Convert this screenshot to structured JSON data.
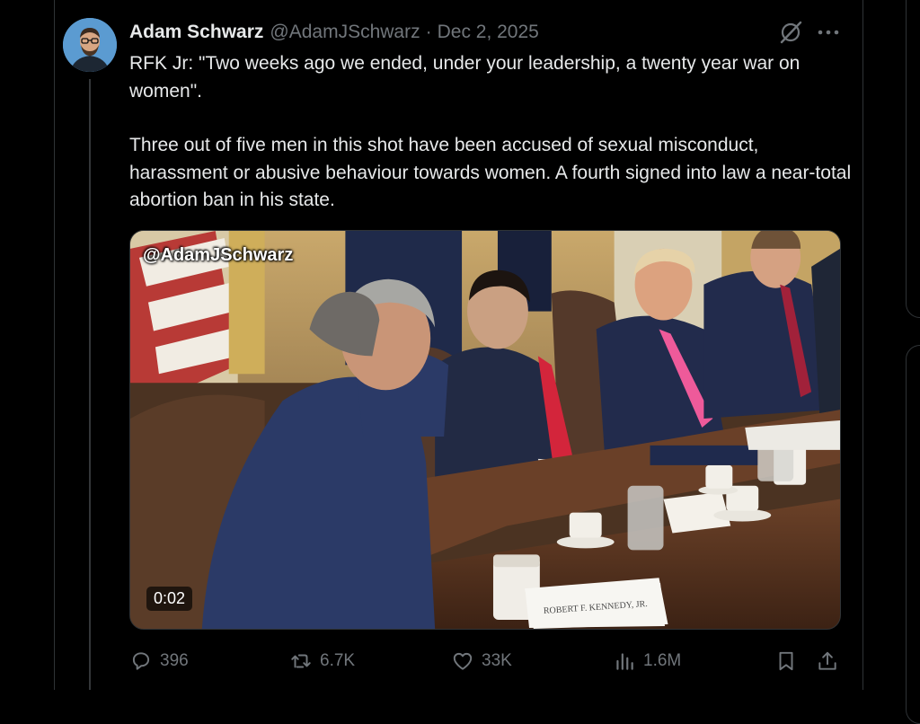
{
  "tweet": {
    "author_name": "Adam Schwarz",
    "handle": "@AdamJSchwarz",
    "separator": "·",
    "date": "Dec 2, 2025",
    "text_paragraph_1": "RFK Jr: \"Two weeks ago we ended, under your leadership, a twenty year war on women\".",
    "text_paragraph_2": "Three out of five men in this shot have been accused of sexual misconduct, harassment or abusive behaviour towards women. A fourth signed into law a near-total abortion ban in his state."
  },
  "media": {
    "watermark": "@AdamJSchwarz",
    "duration": "0:02",
    "placard_text": "ROBERT F. KENNEDY, JR."
  },
  "actions": {
    "reply_count": "396",
    "retweet_count": "6.7K",
    "like_count": "33K",
    "view_count": "1.6M"
  },
  "icons": {
    "header": [
      "grok-icon",
      "more-icon"
    ],
    "actions": [
      "reply-icon",
      "retweet-icon",
      "like-icon",
      "views-icon",
      "bookmark-icon",
      "share-icon"
    ]
  },
  "colors": {
    "background": "#000000",
    "text_primary": "#e7e9ea",
    "text_secondary": "#71767b",
    "border": "#2f3336"
  }
}
